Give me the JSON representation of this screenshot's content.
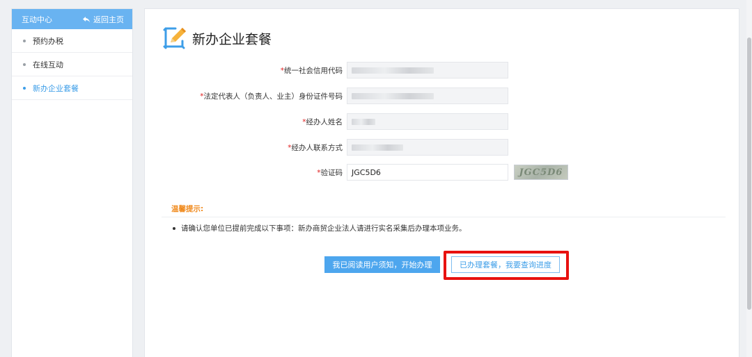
{
  "sidebar": {
    "header_title": "互动中心",
    "back_label": "返回主页",
    "items": [
      {
        "label": "预约办税",
        "active": false
      },
      {
        "label": "在线互动",
        "active": false
      },
      {
        "label": "新办企业套餐",
        "active": true
      }
    ]
  },
  "main": {
    "title": "新办企业套餐",
    "title_icon": "edit-pencil-icon",
    "form": {
      "required_mark": "*",
      "fields": [
        {
          "label": "统一社会信用代码",
          "value": "",
          "masked": true
        },
        {
          "label": "法定代表人（负责人、业主）身份证件号码",
          "value": "",
          "masked": true
        },
        {
          "label": "经办人姓名",
          "value": "",
          "masked": true
        },
        {
          "label": "经办人联系方式",
          "value": "",
          "masked": true
        },
        {
          "label": "验证码",
          "value": "JGC5D6",
          "masked": false
        }
      ],
      "captcha_text": "JGC5D6"
    },
    "tips": {
      "title": "温馨提示:",
      "items": [
        "请确认您单位已提前完成以下事项：新办商贸企业法人请进行实名采集后办理本项业务。"
      ]
    },
    "buttons": {
      "start": "我已阅读用户须知，开始办理",
      "query": "已办理套餐，我要查询进度"
    }
  },
  "colors": {
    "accent": "#4da6ee",
    "sidebar_header": "#69b3f1",
    "required": "#e02020",
    "tips": "#f08a1d",
    "highlight": "#e8110f"
  }
}
